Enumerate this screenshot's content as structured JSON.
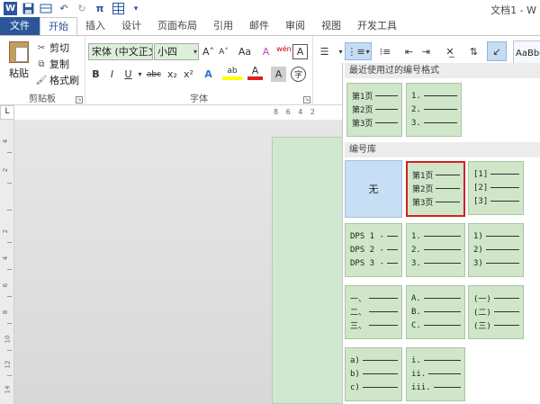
{
  "titlebar": {
    "doc_title": "文档1 - W"
  },
  "tabs": [
    "文件",
    "开始",
    "插入",
    "设计",
    "页面布局",
    "引用",
    "邮件",
    "审阅",
    "视图",
    "开发工具"
  ],
  "active_tab": "开始",
  "clipboard": {
    "paste": "粘贴",
    "cut": "剪切",
    "copy": "复制",
    "format_painter": "格式刷",
    "group_label": "剪贴板"
  },
  "font": {
    "name": "宋体 (中文正文",
    "size": "小四",
    "group_label": "字体",
    "bold": "B",
    "italic": "I",
    "underline": "U",
    "strike": "abc",
    "subscript": "x₂",
    "superscript": "x²",
    "grow": "A˄",
    "shrink": "A˅",
    "change_case": "Aa",
    "clear": "A",
    "phonetic": "wén",
    "border_char": "A",
    "circle_char": "字",
    "text_effects": "A",
    "highlight": "ab",
    "font_color": "A",
    "char_shading": "A"
  },
  "styles": {
    "preview": "AaBbC"
  },
  "ruler": {
    "corner": "L",
    "marks": "8 6 4 2",
    "vertical_ticks": [
      "4",
      "2",
      "2",
      "4",
      "6",
      "8",
      "10",
      "12",
      "14"
    ]
  },
  "numbering_panel": {
    "recent_header": "最近使用过的编号格式",
    "library_header": "编号库",
    "none_label": "无",
    "recent_tiles": [
      [
        "第1页",
        "第2页",
        "第3页"
      ],
      [
        "1.",
        "2.",
        "3."
      ]
    ],
    "library_tiles": [
      [
        "第1页",
        "第2页",
        "第3页"
      ],
      [
        "[1]",
        "[2]",
        "[3]"
      ],
      [
        "DPS 1 -",
        "DPS 2 -",
        "DPS 3 -"
      ],
      [
        "1.",
        "2.",
        "3."
      ],
      [
        "1)",
        "2)",
        "3)"
      ],
      [
        "一、",
        "二、",
        "三、"
      ],
      [
        "A.",
        "B.",
        "C."
      ],
      [
        "(一)",
        "(二)",
        "(三)"
      ],
      [
        "a)",
        "b)",
        "c)"
      ],
      [
        "i.",
        "ii.",
        "iii."
      ]
    ]
  },
  "colors": {
    "accent": "#2b579a",
    "tile_bg": "#cfe6c9",
    "selected_border": "#d41f1f",
    "highlight_yellow": "#ffff00",
    "font_red": "#e02020"
  }
}
